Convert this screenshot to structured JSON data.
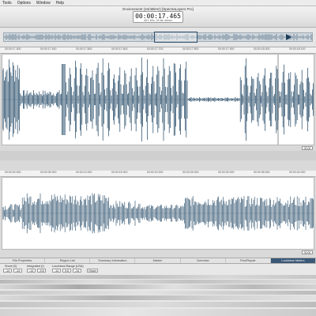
{
  "menu": [
    "Tools",
    "Options",
    "Window",
    "Help"
  ],
  "title": "Environment (24/48kHz) [SpectraLayers Pro]",
  "time_display": {
    "value": "00:00:17.465",
    "sub": "48.1 kHz, 32-bit, stereo"
  },
  "ruler_top": [
    "00:00:17.300",
    "00:00:17.400",
    "00:00:17.500",
    "00:00:17.600",
    "00:00:17.700",
    "00:00:17.800",
    "00:00:17.900",
    "00:00:18.000",
    "00:00:18.100"
  ],
  "ruler_bottom": [
    "00:00:00.000",
    "00:00:05.000",
    "00:00:10.000",
    "00:00:15.000",
    "00:00:20.000",
    "00:00:25.000",
    "00:00:30.000",
    "00:00:35.000",
    "00:00:40.000"
  ],
  "zoom_top": "00:00",
  "zoom_bottom": "00:00",
  "tabs": [
    "File Properties",
    "Region List",
    "Summary Information",
    "Marker",
    "Overview",
    "Find/Repair",
    "Loudness Meters"
  ],
  "active_tab": 6,
  "loudness": {
    "label_short": "Short (S)",
    "label_integrated": "Integrated (I)",
    "label_range": "Loudness Range (LRA)",
    "values": [
      "-14",
      "-14",
      "-14",
      "-9.6",
      "-14",
      "9.6",
      "-14"
    ],
    "reset_label": "Reset"
  },
  "colors": {
    "wave": "#1f4563",
    "accent": "#3a5877"
  }
}
